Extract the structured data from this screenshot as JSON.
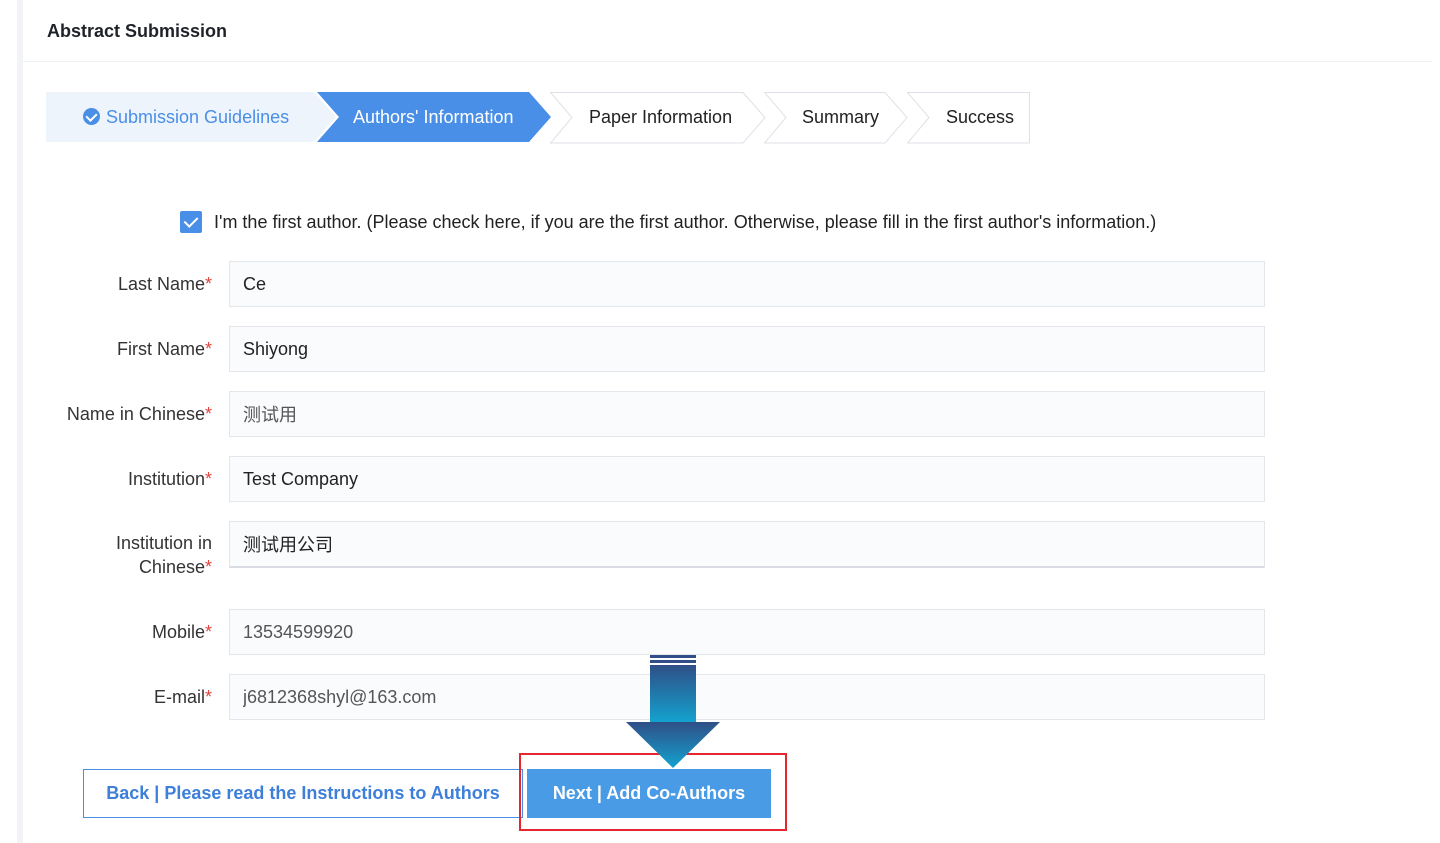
{
  "page": {
    "title": "Abstract Submission"
  },
  "steps": [
    {
      "label": "Submission Guidelines",
      "state": "done"
    },
    {
      "label": "Authors' Information",
      "state": "active"
    },
    {
      "label": "Paper Information",
      "state": "todo"
    },
    {
      "label": "Summary",
      "state": "todo"
    },
    {
      "label": "Success",
      "state": "todo"
    }
  ],
  "first_author": {
    "checked": true,
    "label": "I'm the first author. (Please check here, if you are the first author. Otherwise, please fill in the first author's information.)"
  },
  "form": {
    "required_mark": "*",
    "last_name": {
      "label": "Last Name",
      "value": "Ce"
    },
    "first_name": {
      "label": "First Name",
      "value": "Shiyong"
    },
    "name_chinese": {
      "label": "Name in Chinese",
      "value": "测试用"
    },
    "institution": {
      "label": "Institution",
      "value": "Test Company"
    },
    "institution_chinese": {
      "label_line1": "Institution in",
      "label_line2": "Chinese",
      "value": "测试用公司"
    },
    "mobile": {
      "label": "Mobile",
      "value": "13534599920"
    },
    "email": {
      "label": "E-mail",
      "value": "j6812368shyl@163.com"
    }
  },
  "buttons": {
    "back_label": "Back | Please read the Instructions to Authors",
    "next_label": "Next | Add Co-Authors"
  },
  "colors": {
    "accent": "#4a8fe7",
    "next_button": "#4a9be6",
    "required": "#e0443e",
    "highlight": "#e5272d",
    "arrow_top": "#2f4f86",
    "arrow_bottom": "#13a3d0"
  },
  "icons": {
    "done_step": "check-circle-icon",
    "checkbox": "checkbox-checked-icon",
    "pointer": "down-arrow-icon"
  }
}
